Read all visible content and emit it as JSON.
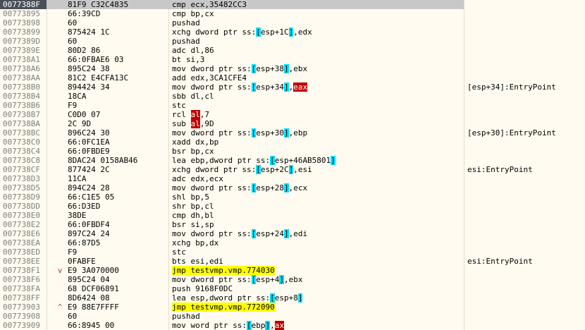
{
  "rows": [
    {
      "addr": "0077388F",
      "bytes": "81F9 C32C4835",
      "fold": "",
      "dis": [
        {
          "t": "cmp ecx,35482CC3"
        }
      ],
      "comment": "",
      "selected": true
    },
    {
      "addr": "00773895",
      "bytes": "66:39CD",
      "fold": "",
      "dis": [
        {
          "t": "cmp bp,cx"
        }
      ],
      "comment": ""
    },
    {
      "addr": "00773898",
      "bytes": "60",
      "fold": "",
      "dis": [
        {
          "t": "pushad"
        }
      ],
      "comment": ""
    },
    {
      "addr": "00773899",
      "bytes": "875424 1C",
      "fold": "",
      "dis": [
        {
          "t": "xchg dword ptr ss:"
        },
        {
          "t": "[",
          "c": "br"
        },
        {
          "t": "esp+1C"
        },
        {
          "t": "]",
          "c": "br"
        },
        {
          "t": ",edx"
        }
      ],
      "comment": ""
    },
    {
      "addr": "0077389D",
      "bytes": "60",
      "fold": "",
      "dis": [
        {
          "t": "pushad"
        }
      ],
      "comment": ""
    },
    {
      "addr": "0077389E",
      "bytes": "80D2 86",
      "fold": "",
      "dis": [
        {
          "t": "adc dl,86"
        }
      ],
      "comment": ""
    },
    {
      "addr": "007738A1",
      "bytes": "66:0FBAE6 03",
      "fold": "",
      "dis": [
        {
          "t": "bt si,3"
        }
      ],
      "comment": ""
    },
    {
      "addr": "007738A6",
      "bytes": "895C24 38",
      "fold": "",
      "dis": [
        {
          "t": "mov dword ptr ss:"
        },
        {
          "t": "[",
          "c": "br"
        },
        {
          "t": "esp+38"
        },
        {
          "t": "]",
          "c": "br"
        },
        {
          "t": ",ebx"
        }
      ],
      "comment": ""
    },
    {
      "addr": "007738AA",
      "bytes": "81C2 E4CFA13C",
      "fold": "",
      "dis": [
        {
          "t": "add edx,3CA1CFE4"
        }
      ],
      "comment": ""
    },
    {
      "addr": "007738B0",
      "bytes": "894424 34",
      "fold": "",
      "dis": [
        {
          "t": "mov dword ptr ss:"
        },
        {
          "t": "[",
          "c": "br"
        },
        {
          "t": "esp+34"
        },
        {
          "t": "]",
          "c": "br"
        },
        {
          "t": ","
        },
        {
          "t": "eax",
          "c": "red"
        }
      ],
      "comment": "[esp+34]:EntryPoint"
    },
    {
      "addr": "007738B4",
      "bytes": "18CA",
      "fold": "",
      "dis": [
        {
          "t": "sbb dl,cl"
        }
      ],
      "comment": ""
    },
    {
      "addr": "007738B6",
      "bytes": "F9",
      "fold": "",
      "dis": [
        {
          "t": "stc"
        }
      ],
      "comment": ""
    },
    {
      "addr": "007738B7",
      "bytes": "C0D0 07",
      "fold": "",
      "dis": [
        {
          "t": "rcl "
        },
        {
          "t": "al",
          "c": "red"
        },
        {
          "t": ",7"
        }
      ],
      "comment": ""
    },
    {
      "addr": "007738BA",
      "bytes": "2C 9D",
      "fold": "",
      "dis": [
        {
          "t": "sub "
        },
        {
          "t": "al",
          "c": "red"
        },
        {
          "t": ",9D"
        }
      ],
      "comment": ""
    },
    {
      "addr": "007738BC",
      "bytes": "896C24 30",
      "fold": "",
      "dis": [
        {
          "t": "mov dword ptr ss:"
        },
        {
          "t": "[",
          "c": "br"
        },
        {
          "t": "esp+30"
        },
        {
          "t": "]",
          "c": "br"
        },
        {
          "t": ",ebp"
        }
      ],
      "comment": "[esp+30]:EntryPoint"
    },
    {
      "addr": "007738C0",
      "bytes": "66:0FC1EA",
      "fold": "",
      "dis": [
        {
          "t": "xadd dx,bp"
        }
      ],
      "comment": ""
    },
    {
      "addr": "007738C4",
      "bytes": "66:0FBDE9",
      "fold": "",
      "dis": [
        {
          "t": "bsr bp,cx"
        }
      ],
      "comment": ""
    },
    {
      "addr": "007738C8",
      "bytes": "8DAC24 0158AB46",
      "fold": "",
      "dis": [
        {
          "t": "lea ebp,dword ptr ss:"
        },
        {
          "t": "[",
          "c": "br"
        },
        {
          "t": "esp+46AB5801"
        },
        {
          "t": "]",
          "c": "br"
        }
      ],
      "comment": ""
    },
    {
      "addr": "007738CF",
      "bytes": "877424 2C",
      "fold": "",
      "dis": [
        {
          "t": "xchg dword ptr ss:"
        },
        {
          "t": "[",
          "c": "br"
        },
        {
          "t": "esp+2C"
        },
        {
          "t": "]",
          "c": "br"
        },
        {
          "t": ",esi"
        }
      ],
      "comment": "esi:EntryPoint"
    },
    {
      "addr": "007738D3",
      "bytes": "11CA",
      "fold": "",
      "dis": [
        {
          "t": "adc edx,ecx"
        }
      ],
      "comment": ""
    },
    {
      "addr": "007738D5",
      "bytes": "894C24 28",
      "fold": "",
      "dis": [
        {
          "t": "mov dword ptr ss:"
        },
        {
          "t": "[",
          "c": "br"
        },
        {
          "t": "esp+28"
        },
        {
          "t": "]",
          "c": "br"
        },
        {
          "t": ",ecx"
        }
      ],
      "comment": ""
    },
    {
      "addr": "007738D9",
      "bytes": "66:C1E5 05",
      "fold": "",
      "dis": [
        {
          "t": "shl bp,5"
        }
      ],
      "comment": ""
    },
    {
      "addr": "007738DD",
      "bytes": "66:D3ED",
      "fold": "",
      "dis": [
        {
          "t": "shr bp,cl"
        }
      ],
      "comment": ""
    },
    {
      "addr": "007738E0",
      "bytes": "38DE",
      "fold": "",
      "dis": [
        {
          "t": "cmp dh,bl"
        }
      ],
      "comment": ""
    },
    {
      "addr": "007738E2",
      "bytes": "66:0FBDF4",
      "fold": "",
      "dis": [
        {
          "t": "bsr si,sp"
        }
      ],
      "comment": ""
    },
    {
      "addr": "007738E6",
      "bytes": "897C24 24",
      "fold": "",
      "dis": [
        {
          "t": "mov dword ptr ss:"
        },
        {
          "t": "[",
          "c": "br"
        },
        {
          "t": "esp+24"
        },
        {
          "t": "]",
          "c": "br"
        },
        {
          "t": ",edi"
        }
      ],
      "comment": ""
    },
    {
      "addr": "007738EA",
      "bytes": "66:87D5",
      "fold": "",
      "dis": [
        {
          "t": "xchg bp,dx"
        }
      ],
      "comment": ""
    },
    {
      "addr": "007738ED",
      "bytes": "F9",
      "fold": "",
      "dis": [
        {
          "t": "stc"
        }
      ],
      "comment": ""
    },
    {
      "addr": "007738EE",
      "bytes": "0FABFE",
      "fold": "",
      "dis": [
        {
          "t": "bts esi,edi"
        }
      ],
      "comment": "esi:EntryPoint"
    },
    {
      "addr": "007738F1",
      "bytes": "E9 3A070000",
      "fold": "v",
      "dis": [
        {
          "t": "jmp testvmp.vmp.774030",
          "c": "jmp"
        }
      ],
      "comment": ""
    },
    {
      "addr": "007738F6",
      "bytes": "895C24 04",
      "fold": "",
      "dis": [
        {
          "t": "mov dword ptr ss:"
        },
        {
          "t": "[",
          "c": "br"
        },
        {
          "t": "esp+4"
        },
        {
          "t": "]",
          "c": "br"
        },
        {
          "t": ",ebx"
        }
      ],
      "comment": ""
    },
    {
      "addr": "007738FA",
      "bytes": "68 DCF06891",
      "fold": "",
      "dis": [
        {
          "t": "push 9168F0DC"
        }
      ],
      "comment": ""
    },
    {
      "addr": "007738FF",
      "bytes": "8D6424 08",
      "fold": "",
      "dis": [
        {
          "t": "lea esp,dword ptr ss:"
        },
        {
          "t": "[",
          "c": "br"
        },
        {
          "t": "esp+8"
        },
        {
          "t": "]",
          "c": "br"
        }
      ],
      "comment": ""
    },
    {
      "addr": "00773903",
      "bytes": "E9 88E7FFFF",
      "fold": "^",
      "dis": [
        {
          "t": "jmp testvmp.vmp.772090",
          "c": "jmp"
        }
      ],
      "comment": ""
    },
    {
      "addr": "00773908",
      "bytes": "60",
      "fold": "",
      "dis": [
        {
          "t": "pushad"
        }
      ],
      "comment": ""
    },
    {
      "addr": "00773909",
      "bytes": "66:8945 00",
      "fold": "",
      "dis": [
        {
          "t": "mov word ptr ss:"
        },
        {
          "t": "[",
          "c": "br"
        },
        {
          "t": "ebp"
        },
        {
          "t": "]",
          "c": "br"
        },
        {
          "t": ","
        },
        {
          "t": "ax",
          "c": "red"
        }
      ],
      "comment": ""
    }
  ]
}
